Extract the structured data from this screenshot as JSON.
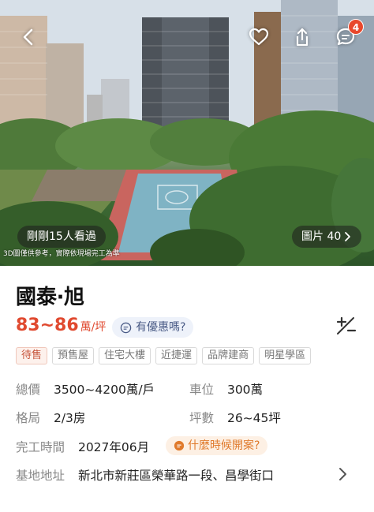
{
  "hero": {
    "viewers_text": "剛剛15人看過",
    "photo_label": "圖片 40",
    "disclaimer": "3D圖僅供參考，實際依現場完工為準",
    "message_count": "4"
  },
  "listing": {
    "name": "國泰‧旭",
    "price_range": "83~86",
    "price_unit": "萬/坪",
    "deal_label": "有優惠嗎?",
    "tags": [
      "待售",
      "預售屋",
      "住宅大樓",
      "近捷運",
      "品牌建商",
      "明星學區"
    ]
  },
  "details": {
    "total_price": {
      "label": "總價",
      "value": "3500~4200萬/戶"
    },
    "parking": {
      "label": "車位",
      "value": "300萬"
    },
    "layout": {
      "label": "格局",
      "value": "2/3房"
    },
    "area": {
      "label": "坪數",
      "value": "26~45坪"
    },
    "completion": {
      "label": "完工時間",
      "value": "2027年06月"
    },
    "open_question": "什麼時候開案?",
    "address": {
      "label": "基地地址",
      "value": "新北市新莊區榮華路一段、昌學街口"
    }
  },
  "colors": {
    "accent_price": "#e0492f",
    "badge": "#e8482c",
    "deal_chip_bg": "#eef2fa",
    "open_chip": "#e07a2c"
  },
  "icons": [
    "back-icon",
    "heart-icon",
    "share-icon",
    "chat-icon",
    "chevron-right-icon",
    "compare-icon",
    "comment-icon"
  ]
}
